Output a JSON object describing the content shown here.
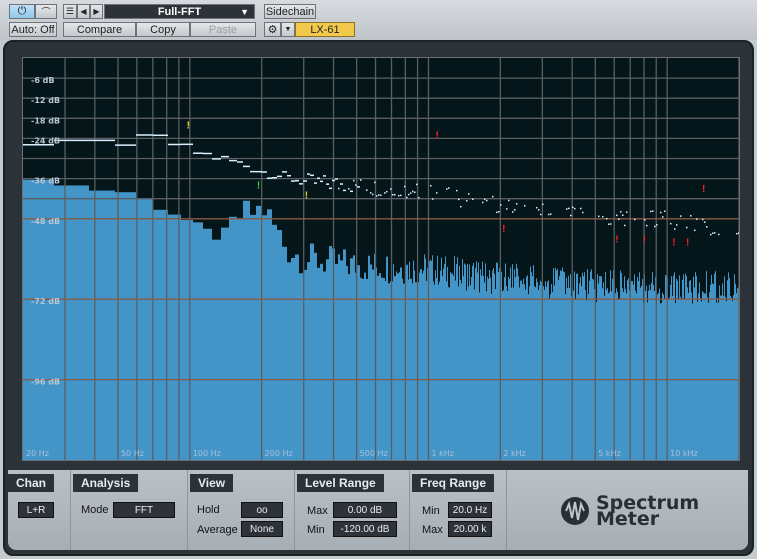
{
  "toolbar": {
    "power_icon": "power-icon",
    "bypass_icon": "bypass-icon",
    "preset_menu_icon": "list-icon",
    "preset_name": "Full-FFT",
    "sidechain": "Sidechain",
    "auto": "Auto: Off",
    "compare": "Compare",
    "copy": "Copy",
    "paste": "Paste",
    "device": "LX-61"
  },
  "colors": {
    "spectrum": "#4395c7",
    "background": "#04161a",
    "accent": "#f2c94c",
    "peak": "#d8f0ff"
  },
  "chart_data": {
    "type": "area",
    "x_scale": "log",
    "xlim": [
      20,
      20000
    ],
    "ylim": [
      -120,
      0
    ],
    "y_ticks": [
      {
        "v": -6,
        "label": "-6 dB"
      },
      {
        "v": -12,
        "label": "-12 dB"
      },
      {
        "v": -18,
        "label": "-18 dB"
      },
      {
        "v": -24,
        "label": "-24 dB"
      },
      {
        "v": -36,
        "label": "-36 dB"
      },
      {
        "v": -48,
        "label": "-48 dB"
      },
      {
        "v": -72,
        "label": "-72 dB"
      },
      {
        "v": -96,
        "label": "-96 dB"
      }
    ],
    "x_ticks": [
      {
        "v": 20,
        "label": "20 Hz"
      },
      {
        "v": 50,
        "label": "50 Hz"
      },
      {
        "v": 100,
        "label": "100 Hz"
      },
      {
        "v": 200,
        "label": "200 Hz"
      },
      {
        "v": 500,
        "label": "500 Hz"
      },
      {
        "v": 1000,
        "label": "1 kHz"
      },
      {
        "v": 2000,
        "label": "2 kHz"
      },
      {
        "v": 5000,
        "label": "5 kHz"
      },
      {
        "v": 10000,
        "label": "10 kHz"
      }
    ],
    "spectrum": {
      "freq": [
        20,
        25,
        50,
        80,
        100,
        130,
        150,
        200,
        250,
        300,
        500,
        1000,
        2000,
        5000,
        10000,
        20000
      ],
      "db": [
        -35,
        -38,
        -40,
        -46,
        -50,
        -54,
        -47,
        -44,
        -56,
        -59,
        -61,
        -62,
        -65,
        -67,
        -68,
        -67
      ]
    },
    "peak_hold": {
      "freq": [
        20,
        30,
        50,
        70,
        100,
        150,
        200,
        300,
        500,
        1000,
        2000,
        5000,
        10000,
        20000
      ],
      "db": [
        -26,
        -26,
        -25,
        -24,
        -28,
        -31,
        -34,
        -37,
        -38,
        -40,
        -44,
        -47,
        -48,
        -52
      ]
    },
    "peak_markers": [
      {
        "f": 97,
        "db": -21,
        "c": "#e0d020"
      },
      {
        "f": 191,
        "db": -39,
        "c": "#40d040"
      },
      {
        "f": 303,
        "db": -42,
        "c": "#e0d020"
      },
      {
        "f": 1070,
        "db": -24,
        "c": "#ff2020"
      },
      {
        "f": 2035,
        "db": -52,
        "c": "#ff2020"
      },
      {
        "f": 6060,
        "db": -55,
        "c": "#ff2020"
      },
      {
        "f": 7900,
        "db": -55,
        "c": "#ff2020"
      },
      {
        "f": 10500,
        "db": -56,
        "c": "#ff2020"
      },
      {
        "f": 12000,
        "db": -56,
        "c": "#ff2020"
      },
      {
        "f": 14000,
        "db": -40,
        "c": "#ff2020"
      }
    ]
  },
  "panel": {
    "chan": {
      "title": "Chan",
      "value": "L+R"
    },
    "analysis": {
      "title": "Analysis",
      "mode_label": "Mode",
      "mode": "FFT"
    },
    "view": {
      "title": "View",
      "hold_label": "Hold",
      "hold": "oo",
      "average_label": "Average",
      "average": "None"
    },
    "level": {
      "title": "Level Range",
      "max_label": "Max",
      "max": "0.00 dB",
      "min_label": "Min",
      "min": "-120.00 dB"
    },
    "freq": {
      "title": "Freq Range",
      "min_label": "Min",
      "min": "20.0 Hz",
      "max_label": "Max",
      "max": "20.00 k"
    },
    "logo": {
      "line1": "Spectrum",
      "line2": "Meter"
    }
  }
}
